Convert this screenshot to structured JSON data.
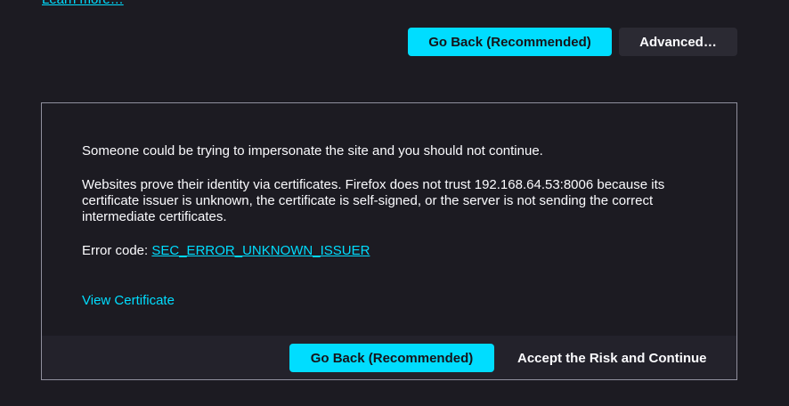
{
  "header": {
    "learn_more": "Learn more…"
  },
  "top_actions": {
    "go_back_label": "Go Back (Recommended)",
    "advanced_label": "Advanced…"
  },
  "advanced_panel": {
    "impersonation_text": "Someone could be trying to impersonate the site and you should not continue.",
    "certificate_explanation": "Websites prove their identity via certificates. Firefox does not trust 192.168.64.53:8006 because its certificate issuer is unknown, the certificate is self-signed, or the server is not sending the correct intermediate certificates.",
    "error_code_label": "Error code: ",
    "error_code_value": "SEC_ERROR_UNKNOWN_ISSUER",
    "view_certificate": "View Certificate",
    "go_back_label": "Go Back (Recommended)",
    "accept_label": "Accept the Risk and Continue"
  },
  "colors": {
    "background": "#1c1b22",
    "accent": "#00ddff",
    "text": "#fbfbfe",
    "secondary_button": "#2b2a33",
    "footer": "#23222b",
    "border": "#8f8f9d"
  }
}
